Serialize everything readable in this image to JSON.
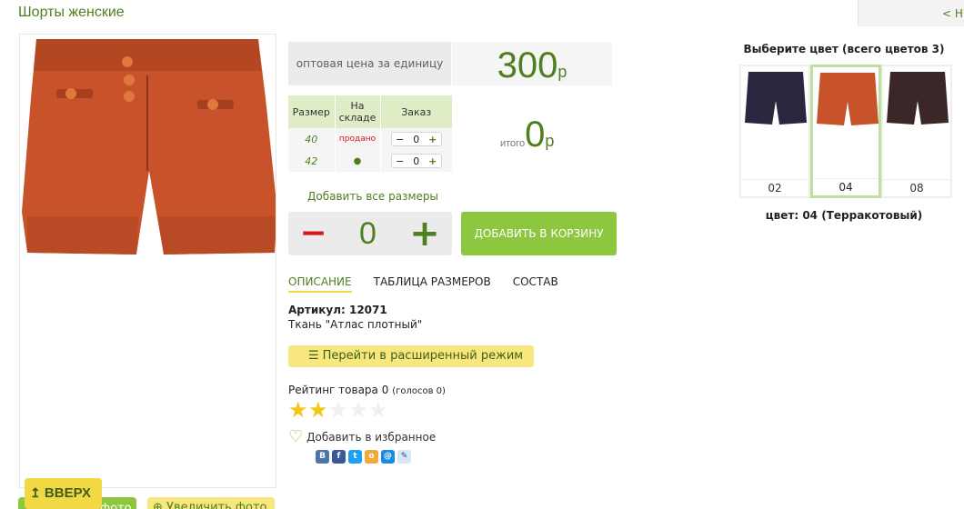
{
  "page": {
    "title": "Шорты женские",
    "nav_prev": "< Н"
  },
  "price": {
    "label": "оптовая цена за единицу",
    "value": "300",
    "currency": "р"
  },
  "size_table": {
    "headers": [
      "Размер",
      "На складе",
      "Заказ"
    ],
    "rows": [
      {
        "size": "40",
        "stock": "продано",
        "qty": "0"
      },
      {
        "size": "42",
        "stock": "●",
        "qty": "0"
      }
    ]
  },
  "total": {
    "label": "итого",
    "value": "0",
    "currency": "р"
  },
  "add_all_sizes": "Добавить все размеры",
  "main_qty": {
    "minus": "−",
    "value": "0",
    "plus": "+"
  },
  "add_to_cart": "ДОБАВИТЬ В КОРЗИНУ",
  "tabs": [
    {
      "label": "ОПИСАНИЕ",
      "active": true
    },
    {
      "label": "ТАБЛИЦА РАЗМЕРОВ",
      "active": false
    },
    {
      "label": "СОСТАВ",
      "active": false
    }
  ],
  "description": {
    "article": "Артикул: 12071",
    "fabric": "Ткань \"Атлас плотный\""
  },
  "advanced_mode": "Перейти в расширенный режим",
  "rating": {
    "label": "Рейтинг товара 0",
    "votes": "(голосов 0)",
    "stars_filled": 2,
    "stars_total": 5
  },
  "favorite": "Добавить в избранное",
  "social_icons": [
    "vk-icon",
    "facebook-icon",
    "twitter-icon",
    "odnoklassniki-icon",
    "mailru-icon",
    "livejournal-icon"
  ],
  "colors": {
    "title": "Выберите цвет (всего цветов 3)",
    "swatches": [
      {
        "code": "02",
        "color": "#2a2640",
        "selected": false
      },
      {
        "code": "04",
        "color": "#c8522a",
        "selected": true
      },
      {
        "code": "08",
        "color": "#3b2727",
        "selected": false
      }
    ],
    "selected_label": "цвет: 04 (Терракотовый)"
  },
  "bottom": {
    "up_button": "ВВЕРХ",
    "photo_button": "фото",
    "zoom_button": "Увеличить фото"
  },
  "accent_green": "#4f7f1e",
  "button_green": "#8dc63f",
  "button_yellow": "#f3d846"
}
